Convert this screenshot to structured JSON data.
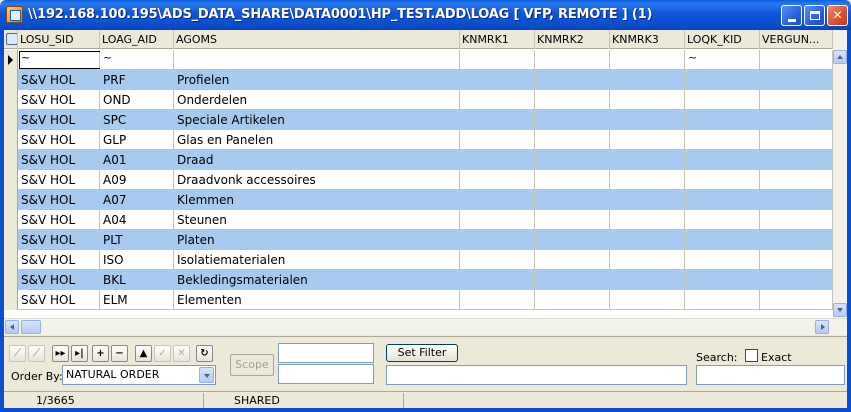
{
  "window": {
    "title": "\\\\192.168.100.195\\ADS_DATA_SHARE\\DATA0001\\HP_TEST.ADD\\LOAG [ VFP, REMOTE ] (1)"
  },
  "grid": {
    "columns": [
      "LOSU_SID",
      "LOAG_AID",
      "AGOMS",
      "KNMRK1",
      "KNMRK2",
      "KNMRK3",
      "LOQK_KID",
      "VERGUN..."
    ],
    "filter_row": [
      "~",
      "~",
      "",
      "",
      "",
      "",
      "~",
      ""
    ],
    "rows": [
      [
        "S&V HOL",
        "PRF",
        "Profielen"
      ],
      [
        "S&V HOL",
        "OND",
        "Onderdelen"
      ],
      [
        "S&V HOL",
        "SPC",
        "Speciale Artikelen"
      ],
      [
        "S&V HOL",
        "GLP",
        "Glas en Panelen"
      ],
      [
        "S&V HOL",
        "A01",
        "Draad"
      ],
      [
        "S&V HOL",
        "A09",
        "Draadvonk accessoires"
      ],
      [
        "S&V HOL",
        "A07",
        "Klemmen"
      ],
      [
        "S&V HOL",
        "A04",
        "Steunen"
      ],
      [
        "S&V HOL",
        "PLT",
        "Platen"
      ],
      [
        "S&V HOL",
        "ISO",
        "Isolatiematerialen"
      ],
      [
        "S&V HOL",
        "BKL",
        "Bekledingsmaterialen"
      ],
      [
        "S&V HOL",
        "ELM",
        "Elementen"
      ]
    ]
  },
  "toolbar": {
    "order_by_label": "Order By:",
    "order_by_value": "NATURAL ORDER",
    "scope_label": "Scope",
    "set_filter_label": "Set Filter",
    "search_label": "Search:",
    "exact_label": "Exact"
  },
  "status": {
    "position": "1/3665",
    "mode": "SHARED"
  }
}
